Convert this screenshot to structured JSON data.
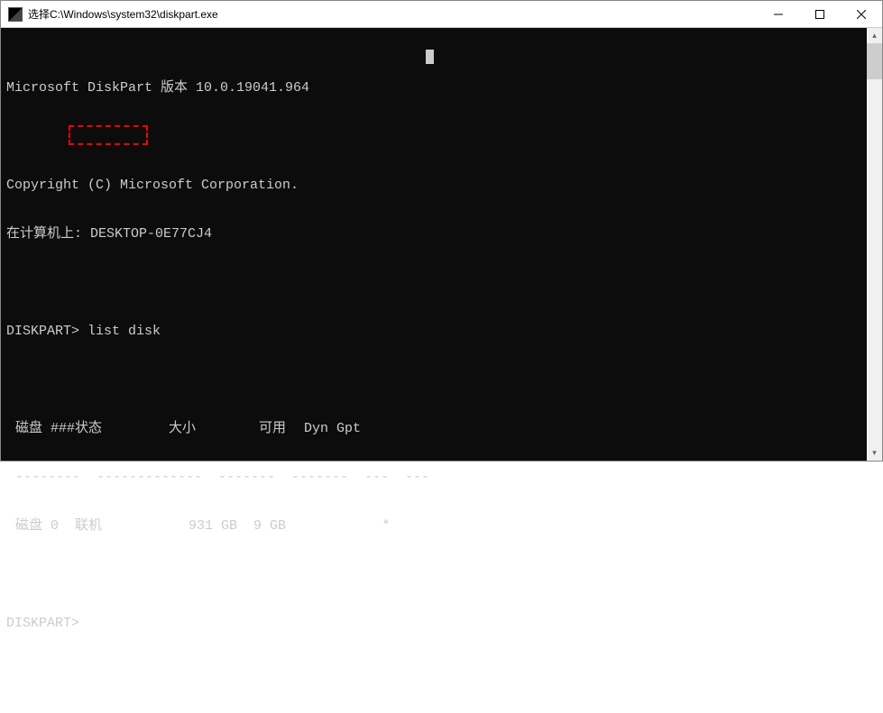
{
  "window": {
    "title": "选择C:\\Windows\\system32\\diskpart.exe"
  },
  "terminal": {
    "version_line": "Microsoft DiskPart 版本 10.0.19041.964",
    "copyright_line": "Copyright (C) Microsoft Corporation.",
    "computer_line": "在计算机上: DESKTOP-0E77CJ4",
    "prompt1": "DISKPART>",
    "command1": "list disk",
    "table": {
      "headers": {
        "disk_num": "磁盘 ###",
        "status": "状态",
        "size": "大小",
        "free": "可用",
        "dyn": "Dyn",
        "gpt": "Gpt"
      },
      "divider": "--------  -------------  -------  -------  ---  ---",
      "rows": [
        {
          "disk_num": "磁盘 0",
          "status": "联机",
          "size": "931 GB",
          "free": "9 GB",
          "dyn": "",
          "gpt": "*"
        }
      ]
    },
    "prompt2": "DISKPART>"
  }
}
